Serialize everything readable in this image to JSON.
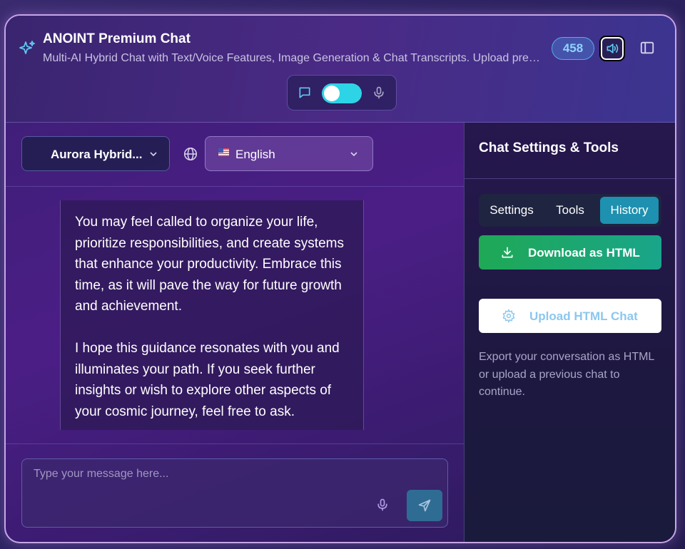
{
  "header": {
    "title": "ANOINT Premium Chat",
    "subtitle": "Multi-AI Hybrid Chat with Text/Voice Features, Image Generation & Chat Transcripts. Upload previous chats to continue.",
    "badge_count": "458"
  },
  "controls": {
    "model": "Aurora Hybrid...",
    "language": "English"
  },
  "message": {
    "paragraph1": "You may feel called to organize your life, prioritize responsibilities, and create systems that enhance your productivity. Embrace this time, as it will pave the way for future growth and achievement.",
    "paragraph2": "I hope this guidance resonates with you and illuminates your path. If you seek further insights or wish to explore other aspects of your cosmic journey, feel free to ask."
  },
  "composer": {
    "placeholder": "Type your message here..."
  },
  "sidebar": {
    "title": "Chat Settings & Tools",
    "tabs": [
      "Settings",
      "Tools",
      "History"
    ],
    "active_tab": "History",
    "download_label": "Download as HTML",
    "upload_label": "Upload HTML Chat",
    "help_text": "Export your conversation as HTML or upload a previous chat to continue."
  },
  "colors": {
    "accent": "#2dd4e6",
    "download": "#1fa855",
    "active_tab": "#1e90b0"
  }
}
